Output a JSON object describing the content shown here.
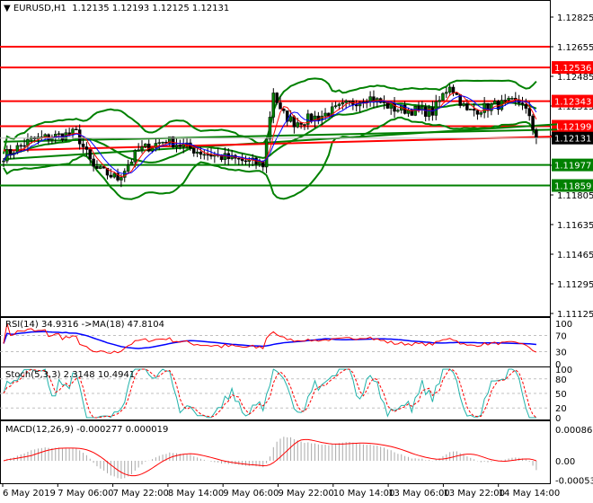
{
  "header": {
    "symbol": "EURUSD,H1",
    "open": "1.12135",
    "high": "1.12193",
    "low": "1.12125",
    "close": "1.12131"
  },
  "chart_data": {
    "type": "candlestick",
    "symbol": "EURUSD",
    "timeframe": "H1",
    "ylim": [
      1.11125,
      1.12825
    ],
    "price_ticks": [
      "1.12825",
      "1.12655",
      "1.12485",
      "1.12315",
      "1.12145",
      "1.11975",
      "1.11805",
      "1.11635",
      "1.11465",
      "1.11295",
      "1.11125"
    ],
    "time_labels": [
      "6 May 2019",
      "7 May 06:00",
      "7 May 22:00",
      "8 May 14:00",
      "9 May 06:00",
      "9 May 22:00",
      "10 May 14:00",
      "13 May 06:00",
      "13 May 22:00",
      "14 May 14:00"
    ],
    "bars": 155,
    "close_keypoints": [
      [
        0,
        1.1203
      ],
      [
        8,
        1.1212
      ],
      [
        21,
        1.1216
      ],
      [
        26,
        1.1196
      ],
      [
        33,
        1.119
      ],
      [
        39,
        1.1206
      ],
      [
        47,
        1.1212
      ],
      [
        57,
        1.1205
      ],
      [
        66,
        1.1201
      ],
      [
        75,
        1.1198
      ],
      [
        78,
        1.124
      ],
      [
        80,
        1.1228
      ],
      [
        84,
        1.1222
      ],
      [
        92,
        1.1226
      ],
      [
        105,
        1.1237
      ],
      [
        113,
        1.123
      ],
      [
        124,
        1.1228
      ],
      [
        129,
        1.1244
      ],
      [
        134,
        1.1228
      ],
      [
        142,
        1.1232
      ],
      [
        150,
        1.1234
      ],
      [
        154,
        1.12131
      ]
    ],
    "levels": [
      {
        "price": 1.12655,
        "color": "#ff0000",
        "label": ""
      },
      {
        "price": 1.12536,
        "color": "#ff0000",
        "label": "1.12536"
      },
      {
        "price": 1.12343,
        "color": "#ff0000",
        "label": "1.12343"
      },
      {
        "price": 1.12199,
        "color": "#ff0000",
        "label": "1.12199"
      },
      {
        "price": 1.11977,
        "color": "#008000",
        "label": "1.11977"
      },
      {
        "price": 1.11859,
        "color": "#008000",
        "label": "1.11859"
      }
    ],
    "current_price": "1.12131",
    "trendlines": [
      {
        "from": [
          0,
          1.1211
        ],
        "to": [
          160,
          1.1218
        ],
        "color": "#008000"
      },
      {
        "from": [
          0,
          1.1201
        ],
        "to": [
          160,
          1.1221
        ],
        "color": "#008000"
      },
      {
        "from": [
          0,
          1.1206
        ],
        "to": [
          160,
          1.1214
        ],
        "color": "#ff0000"
      }
    ],
    "rsi": {
      "label": "RSI(14) 34.9316  ->MA(18) 47.8104",
      "levels": [
        "100",
        "70",
        "30",
        "0"
      ]
    },
    "stoch": {
      "label": "Stoch(5,3,3) 2.3148 10.4941",
      "levels": [
        "100",
        "80",
        "50",
        "20",
        "0"
      ]
    },
    "macd": {
      "label": "MACD(12,26,9) -0.000277 0.000019",
      "levels": [
        "0.000869",
        "0.00",
        "-0.000536"
      ]
    }
  }
}
